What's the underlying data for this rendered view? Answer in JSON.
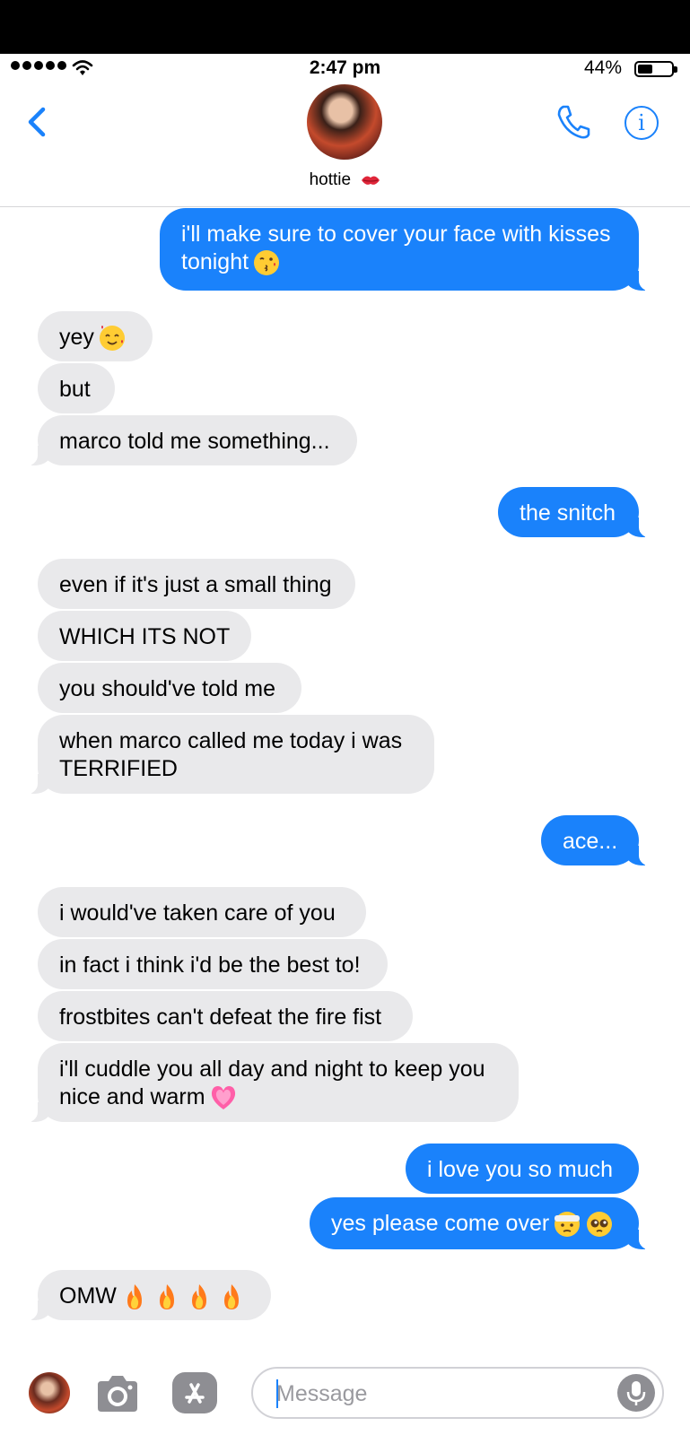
{
  "status_bar": {
    "time": "2:47 pm",
    "battery": "44%",
    "battery_level": 0.44
  },
  "header": {
    "contact_name": "hottie",
    "info_label": "i"
  },
  "messages": [
    {
      "dir": "out",
      "lines": [
        "i'll make sure to cover your face with kisses",
        "tonight"
      ],
      "emoji": [
        "kissing-heart-emoji"
      ]
    },
    {
      "dir": "in",
      "text": "yey",
      "emoji": [
        "smiling-hearts-emoji"
      ]
    },
    {
      "dir": "in",
      "text": "but"
    },
    {
      "dir": "in",
      "text": "marco told me something..."
    },
    {
      "dir": "out",
      "text": "the snitch"
    },
    {
      "dir": "in",
      "text": "even if it's just a small thing"
    },
    {
      "dir": "in",
      "text": "WHICH ITS NOT"
    },
    {
      "dir": "in",
      "text": "you should've told me"
    },
    {
      "dir": "in",
      "lines": [
        "when marco called me today i was",
        "TERRIFIED"
      ]
    },
    {
      "dir": "out",
      "text": "ace..."
    },
    {
      "dir": "in",
      "text": "i would've taken care of you"
    },
    {
      "dir": "in",
      "text": "in fact i think i'd be the best to!"
    },
    {
      "dir": "in",
      "text": "frostbites can't defeat the fire fist"
    },
    {
      "dir": "in",
      "lines": [
        "i'll cuddle you all day and night to keep you",
        "nice and warm"
      ],
      "emoji": [
        "growing-heart-emoji"
      ]
    },
    {
      "dir": "out",
      "text": "i love you so much"
    },
    {
      "dir": "out",
      "text": "yes please come over",
      "emoji": [
        "bandaged-face-emoji",
        "pleading-face-emoji"
      ]
    },
    {
      "dir": "in",
      "text": "OMW",
      "emoji": [
        "fire-emoji",
        "fire-emoji",
        "fire-emoji",
        "fire-emoji"
      ]
    }
  ],
  "composer": {
    "placeholder": "Message",
    "value": ""
  },
  "colors": {
    "accent": "#1a82fb",
    "incoming": "#e9e9eb",
    "outgoing_text": "#ffffff"
  }
}
